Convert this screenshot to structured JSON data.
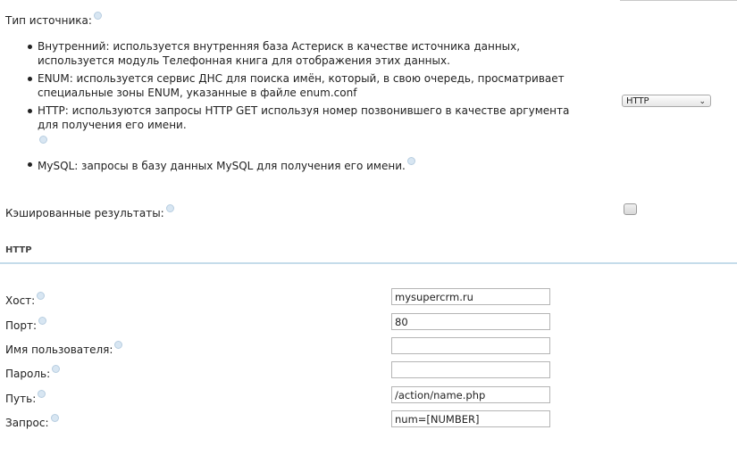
{
  "source": {
    "label": "Тип источника:",
    "options": [
      {
        "line1": "Внутренний: используется внутренняя база Астериск в качестве источника данных,",
        "line2": "используется модуль Телефонная книга для отображения этих данных."
      },
      {
        "line1": "ENUM: используется сервис ДНС для поиска имён, который, в свою очередь, просматривает",
        "line2": "специальные зоны ENUM, указанные в файле enum.conf"
      },
      {
        "line1": "HTTP: используются запросы HTTP GET используя номер позвонившего в качестве аргумента",
        "line2": "для получения его имени."
      },
      {
        "line1": "MySQL: запросы в базу данных MySQL для получения его имени."
      }
    ],
    "selected": "HTTP"
  },
  "cache": {
    "label": "Кэшированные результаты:",
    "checked": false
  },
  "http": {
    "title": "HTTP",
    "fields": [
      {
        "label": "Хост:",
        "value": "mysupercrm.ru"
      },
      {
        "label": "Порт:",
        "value": "80"
      },
      {
        "label": "Имя пользователя:",
        "value": ""
      },
      {
        "label": "Пароль:",
        "value": ""
      },
      {
        "label": "Путь:",
        "value": "/action/name.php"
      },
      {
        "label": "Запрос:",
        "value": "num=[NUMBER]"
      }
    ]
  },
  "icons": {
    "help": "help-circle-icon",
    "bullet": "bullet-icon",
    "dropdown": "chevron-down-icon"
  },
  "colors": {
    "divider": "#c5dcea",
    "help_icon": "#d8e6f2"
  }
}
